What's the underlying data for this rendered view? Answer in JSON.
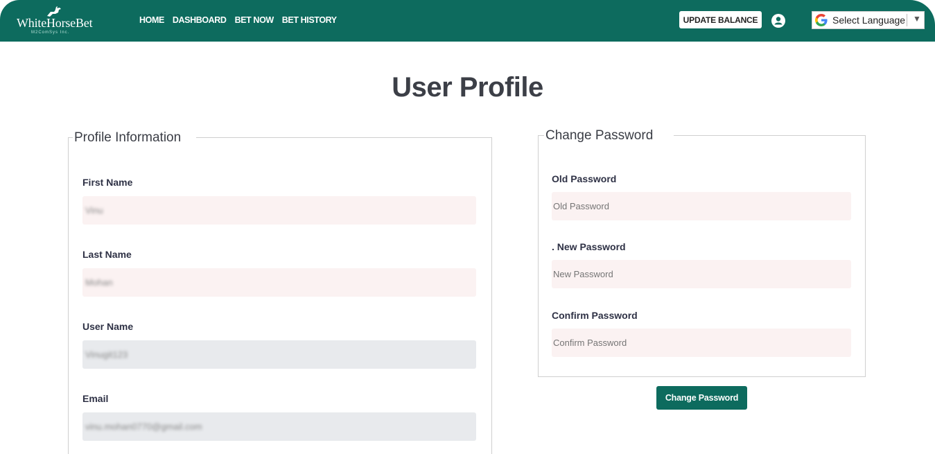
{
  "header": {
    "logo_text": "WhiteHorseBet",
    "logo_subtext": "M2ComSys Inc.",
    "nav": [
      "HOME",
      "DASHBOARD",
      "BET NOW",
      "BET HISTORY"
    ],
    "update_balance": "UPDATE BALANCE",
    "language_label": "Select Language",
    "language_arrow": "▼"
  },
  "page": {
    "title": "User Profile"
  },
  "profile": {
    "legend": "Profile Information",
    "first_name": {
      "label": "First Name",
      "value": "Vinu"
    },
    "last_name": {
      "label": "Last Name",
      "value": "Mohan"
    },
    "user_name": {
      "label": "User Name",
      "value": "Vinugit123"
    },
    "email": {
      "label": "Email",
      "value": "vinu.mohan0770@gmail.com"
    }
  },
  "password": {
    "legend": "Change Password",
    "old": {
      "label": "Old Password",
      "placeholder": "Old Password"
    },
    "new": {
      "label": ". New Password",
      "placeholder": "New Password"
    },
    "confirm": {
      "label": "Confirm Password",
      "placeholder": "Confirm Password"
    },
    "button": "Change Password"
  },
  "colors": {
    "brand": "#0d6b5e",
    "field_pink": "#fbf2f2",
    "field_grey": "#e8eaed"
  }
}
